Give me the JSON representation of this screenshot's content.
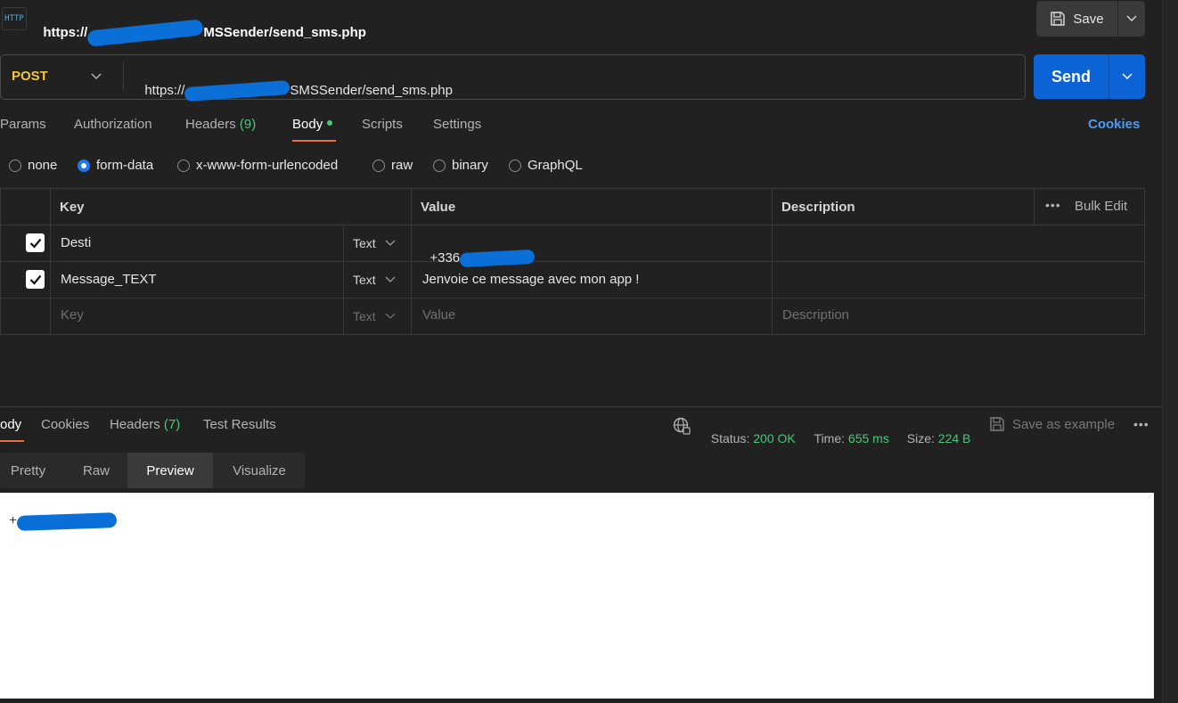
{
  "header": {
    "tab_title_prefix": "https://",
    "tab_title_suffix": "MSSender/send_sms.php",
    "icon_label": "HTTP",
    "save_label": "Save"
  },
  "request": {
    "method": "POST",
    "url_prefix": "https://",
    "url_suffix": "SMSSender/send_sms.php",
    "send_label": "Send"
  },
  "request_tabs": {
    "params": "Params",
    "authorization": "Authorization",
    "headers": "Headers",
    "headers_count": "(9)",
    "body": "Body",
    "scripts": "Scripts",
    "settings": "Settings",
    "cookies": "Cookies"
  },
  "body_types": {
    "none": "none",
    "form_data": "form-data",
    "urlencoded": "x-www-form-urlencoded",
    "raw": "raw",
    "binary": "binary",
    "graphql": "GraphQL",
    "selected": "form-data"
  },
  "table": {
    "col_key": "Key",
    "col_value": "Value",
    "col_description": "Description",
    "bulk_edit": "Bulk Edit",
    "rows": [
      {
        "key": "Desti",
        "type": "Text",
        "value": "+336",
        "checked": true
      },
      {
        "key": "Message_TEXT",
        "type": "Text",
        "value": "Jenvoie ce message avec mon app !",
        "checked": true
      }
    ],
    "placeholder_key": "Key",
    "placeholder_type": "Text",
    "placeholder_value": "Value",
    "placeholder_description": "Description"
  },
  "response": {
    "tab_body": "ody",
    "tab_cookies": "Cookies",
    "tab_headers": "Headers",
    "headers_count": "(7)",
    "tab_test_results": "Test Results",
    "status_label": "Status:",
    "status_value": "200 OK",
    "time_label": "Time:",
    "time_value": "655 ms",
    "size_label": "Size:",
    "size_value": "224 B",
    "save_example": "Save as example",
    "views": [
      "Pretty",
      "Raw",
      "Preview",
      "Visualize"
    ],
    "active_view": "Preview",
    "preview_text": "+"
  },
  "colors": {
    "accent_blue": "#0b63d6",
    "method_yellow": "#f5c43a",
    "success_green": "#49c77a",
    "active_underline": "#e96e3c"
  }
}
